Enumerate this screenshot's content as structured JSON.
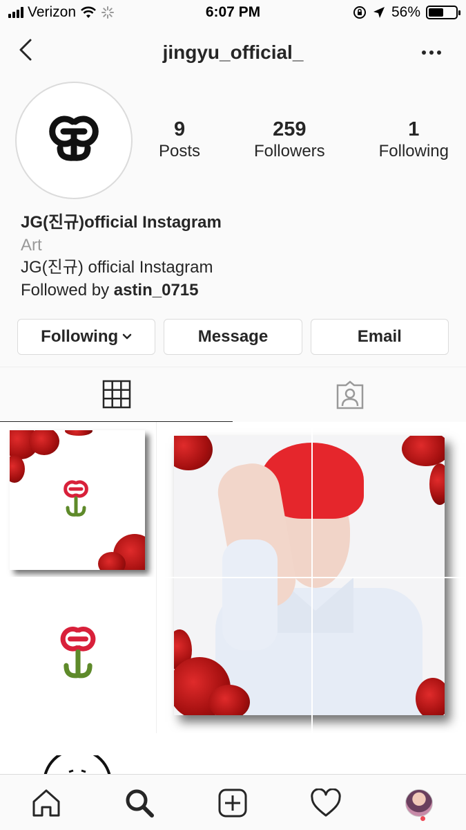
{
  "status_bar": {
    "carrier": "Verizon",
    "time": "6:07 PM",
    "battery": "56%",
    "battery_level": 0.56
  },
  "header": {
    "username": "jingyu_official_"
  },
  "profile": {
    "stats": [
      {
        "count": "9",
        "label": "Posts"
      },
      {
        "count": "259",
        "label": "Followers"
      },
      {
        "count": "1",
        "label": "Following"
      }
    ],
    "name": "JG(진규)official Instagram",
    "category": "Art",
    "bio": "JG(진규) official Instagram",
    "followed_by_prefix": "Followed by",
    "followed_by_user": "astin_0715"
  },
  "actions": {
    "following_label": "Following",
    "message_label": "Message",
    "email_label": "Email"
  },
  "tabs": [
    {
      "name": "grid-tab",
      "icon": "grid-icon",
      "active": true
    },
    {
      "name": "tagged-tab",
      "icon": "tagged-person-icon",
      "active": false
    }
  ],
  "bottom_nav": [
    {
      "icon": "home-icon"
    },
    {
      "icon": "search-icon"
    },
    {
      "icon": "add-post-icon"
    },
    {
      "icon": "heart-icon"
    },
    {
      "icon": "profile-avatar-icon"
    }
  ],
  "colors": {
    "logo_red": "#d8203a",
    "logo_green": "#5e8a2a",
    "rose_red": "#c0141b",
    "hair_red": "#e5262c",
    "notification_dot": "#ed4956"
  }
}
